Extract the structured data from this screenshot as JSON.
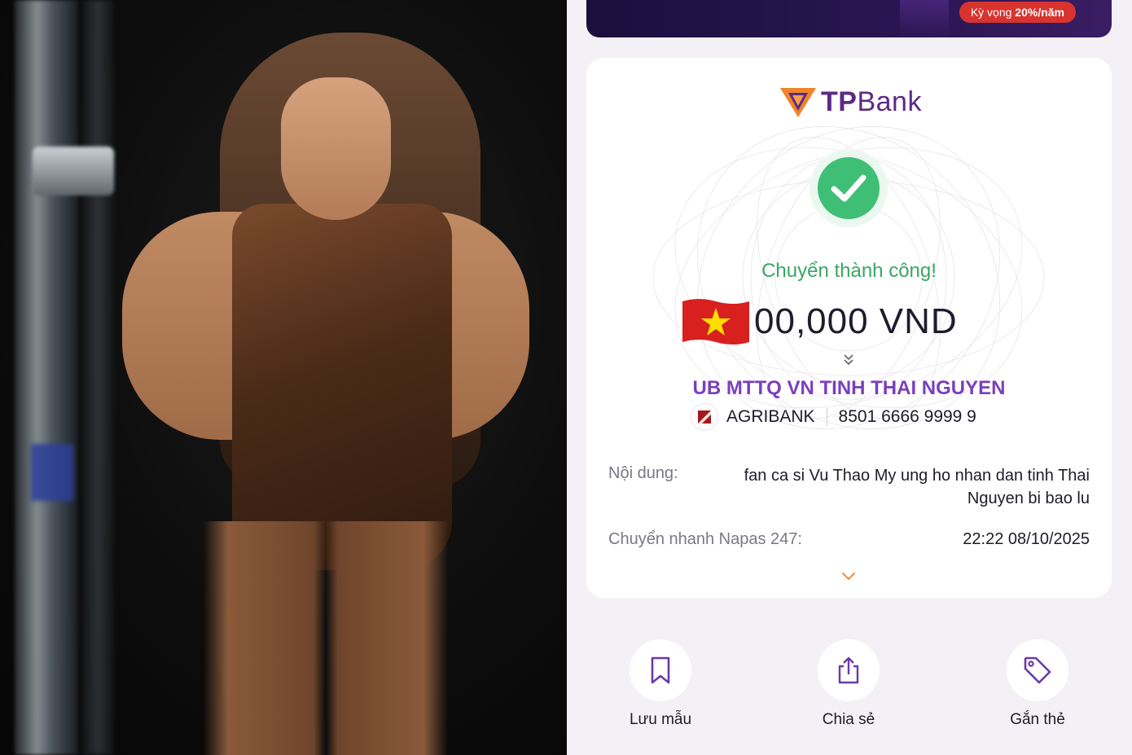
{
  "banner": {
    "pill_prefix": "Kỳ vọng ",
    "pill_rate": "20%/năm"
  },
  "receipt": {
    "logo_text_bold": "TP",
    "logo_text_rest": "Bank",
    "status": "Chuyển thành công!",
    "amount": "00,000 VND",
    "receiver_name": "UB MTTQ VN TINH THAI NGUYEN",
    "bank_name": "AGRIBANK",
    "account_number": "8501 6666 9999 9",
    "content_label": "Nội dung:",
    "content_value": "fan ca si Vu Thao My ung ho nhan dan tinh Thai Nguyen bi bao lu",
    "transfer_label": "Chuyển nhanh Napas 247:",
    "transfer_time": "22:22 08/10/2025"
  },
  "actions": [
    {
      "label": "Lưu mẫu",
      "icon": "bookmark-icon"
    },
    {
      "label": "Chia sẻ",
      "icon": "share-icon"
    },
    {
      "label": "Gắn thẻ",
      "icon": "tag-icon"
    }
  ],
  "colors": {
    "brand_purple": "#5b2a86",
    "success_green": "#3fbf76",
    "receiver_purple": "#7a3fbd",
    "banner_red": "#d8342f"
  }
}
